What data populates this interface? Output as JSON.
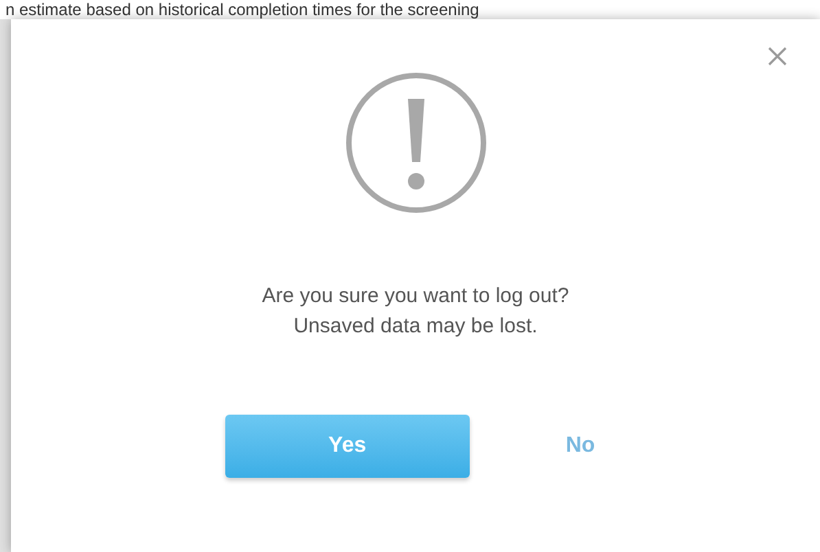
{
  "background": {
    "text": "n estimate based on historical completion times for the screening"
  },
  "dialog": {
    "message": "Are you sure you want to log out?",
    "detail": "Unsaved data may be lost.",
    "buttons": [
      {
        "label": "Yes",
        "kind": "primary"
      },
      {
        "label": "No",
        "kind": "link"
      }
    ]
  }
}
